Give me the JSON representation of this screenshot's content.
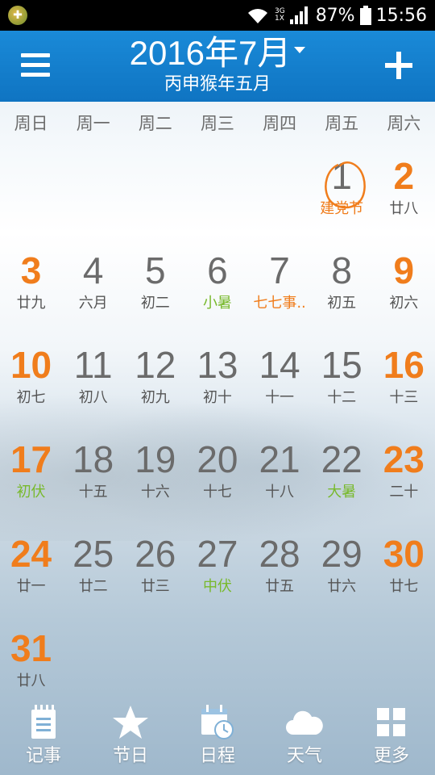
{
  "status": {
    "network": "3G",
    "network2": "1X",
    "battery": "87%",
    "time": "15:56"
  },
  "header": {
    "title": "2016年7月",
    "subtitle": "丙申猴年五月"
  },
  "weekdays": [
    "周日",
    "周一",
    "周二",
    "周三",
    "周四",
    "周五",
    "周六"
  ],
  "weeks": [
    [
      {
        "d": "",
        "l": ""
      },
      {
        "d": "",
        "l": ""
      },
      {
        "d": "",
        "l": ""
      },
      {
        "d": "",
        "l": ""
      },
      {
        "d": "",
        "l": ""
      },
      {
        "d": "1",
        "l": "建党节",
        "kind": "holiday"
      },
      {
        "d": "2",
        "l": "廿八"
      }
    ],
    [
      {
        "d": "3",
        "l": "廿九"
      },
      {
        "d": "4",
        "l": "六月"
      },
      {
        "d": "5",
        "l": "初二"
      },
      {
        "d": "6",
        "l": "小暑",
        "kind": "term"
      },
      {
        "d": "7",
        "l": "七七事..",
        "kind": "holiday"
      },
      {
        "d": "8",
        "l": "初五"
      },
      {
        "d": "9",
        "l": "初六"
      }
    ],
    [
      {
        "d": "10",
        "l": "初七"
      },
      {
        "d": "11",
        "l": "初八"
      },
      {
        "d": "12",
        "l": "初九"
      },
      {
        "d": "13",
        "l": "初十"
      },
      {
        "d": "14",
        "l": "十一"
      },
      {
        "d": "15",
        "l": "十二"
      },
      {
        "d": "16",
        "l": "十三"
      }
    ],
    [
      {
        "d": "17",
        "l": "初伏",
        "kind": "term"
      },
      {
        "d": "18",
        "l": "十五"
      },
      {
        "d": "19",
        "l": "十六"
      },
      {
        "d": "20",
        "l": "十七"
      },
      {
        "d": "21",
        "l": "十八"
      },
      {
        "d": "22",
        "l": "大暑",
        "kind": "term"
      },
      {
        "d": "23",
        "l": "二十"
      }
    ],
    [
      {
        "d": "24",
        "l": "廿一"
      },
      {
        "d": "25",
        "l": "廿二"
      },
      {
        "d": "26",
        "l": "廿三"
      },
      {
        "d": "27",
        "l": "中伏",
        "kind": "term"
      },
      {
        "d": "28",
        "l": "廿五"
      },
      {
        "d": "29",
        "l": "廿六"
      },
      {
        "d": "30",
        "l": "廿七"
      }
    ],
    [
      {
        "d": "31",
        "l": "廿八"
      },
      {
        "d": "",
        "l": ""
      },
      {
        "d": "",
        "l": ""
      },
      {
        "d": "",
        "l": ""
      },
      {
        "d": "",
        "l": ""
      },
      {
        "d": "",
        "l": ""
      },
      {
        "d": "",
        "l": ""
      }
    ]
  ],
  "today": "1",
  "nav": [
    {
      "label": "记事",
      "icon": "notes-icon"
    },
    {
      "label": "节日",
      "icon": "star-icon"
    },
    {
      "label": "日程",
      "icon": "schedule-icon"
    },
    {
      "label": "天气",
      "icon": "cloud-icon"
    },
    {
      "label": "更多",
      "icon": "grid-icon"
    }
  ],
  "colors": {
    "header": "#1184d0",
    "weekend": "#f07d1c",
    "term": "#78b92c",
    "holiday": "#f07d1c"
  }
}
